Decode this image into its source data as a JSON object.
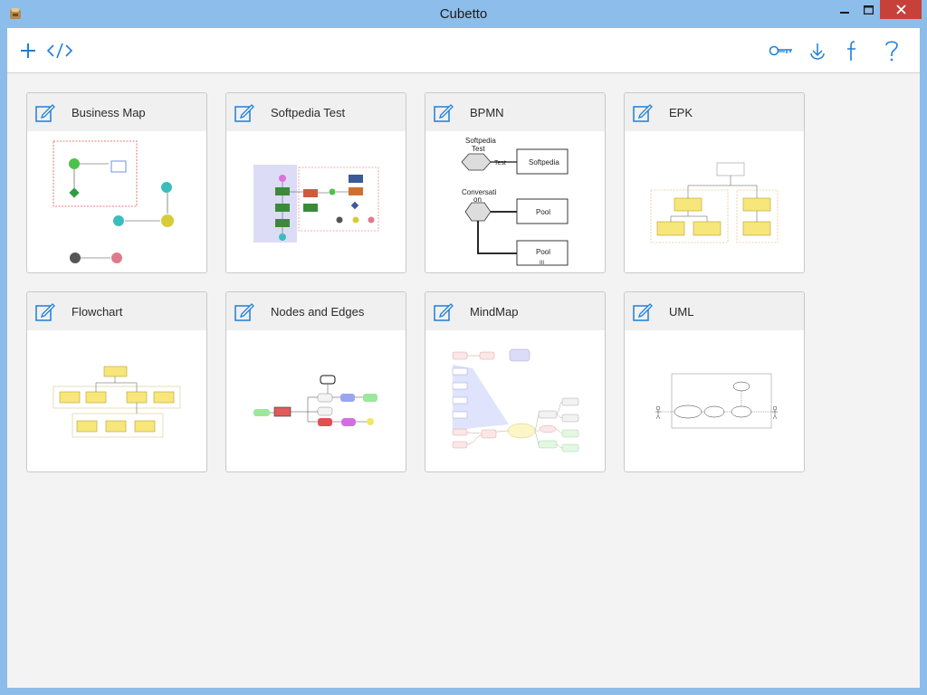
{
  "window": {
    "title": "Cubetto"
  },
  "toolbar": {
    "left": [
      {
        "icon": "plus-icon"
      },
      {
        "icon": "code-icon"
      }
    ],
    "right": [
      {
        "icon": "key-icon"
      },
      {
        "icon": "download-icon"
      },
      {
        "icon": "facebook-icon"
      },
      {
        "icon": "help-icon"
      }
    ]
  },
  "cards": [
    {
      "title": "Business Map"
    },
    {
      "title": "Softpedia Test"
    },
    {
      "title": "BPMN"
    },
    {
      "title": "EPK"
    },
    {
      "title": "Flowchart"
    },
    {
      "title": "Nodes and Edges"
    },
    {
      "title": "MindMap"
    },
    {
      "title": "UML"
    }
  ],
  "thumbs": {
    "bpmn": {
      "softpedia_test": "Softpedia",
      "test_word": "Test",
      "test_edge": "Test",
      "softpedia_box": "Softpedia",
      "conversation": "Conversati",
      "conversation2": "on",
      "pool1": "Pool",
      "pool2": "Pool",
      "pool2_sub": "III"
    }
  },
  "colors": {
    "accent": "#1e7fd8",
    "close": "#c7403a"
  }
}
